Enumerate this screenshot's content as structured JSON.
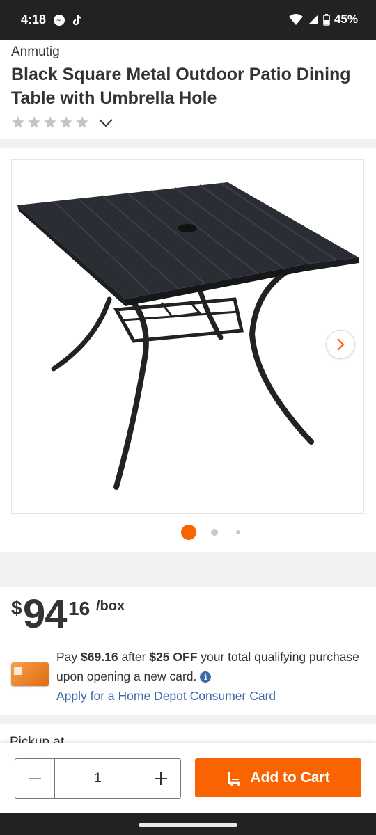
{
  "status_bar": {
    "time": "4:18",
    "battery": "45%"
  },
  "product": {
    "brand": "Anmutig",
    "title": "Black Square Metal Outdoor Patio Dining Table with Umbrella Hole",
    "rating_stars": 0,
    "image_count": 3,
    "current_image": 1
  },
  "price": {
    "currency": "$",
    "dollars": "94",
    "cents": "16",
    "unit": "/box"
  },
  "offer": {
    "pay_label": "Pay",
    "pay_amount": "$69.16",
    "after_label": "after",
    "discount": "$25 OFF",
    "tail": "your total qualifying purchase upon opening a new card.",
    "apply_link": "Apply for a Home Depot Consumer Card"
  },
  "pickup": {
    "label": "Pickup at"
  },
  "cart": {
    "quantity": "1",
    "add_label": "Add to Cart"
  },
  "colors": {
    "accent": "#f96302",
    "link": "#3c6aa8",
    "text": "#333333"
  }
}
